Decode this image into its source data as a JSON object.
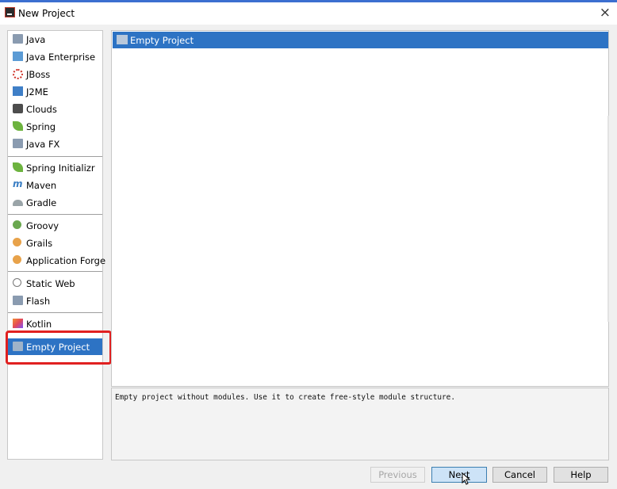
{
  "window": {
    "title": "New Project",
    "close_icon": "×"
  },
  "sidebar": {
    "items": [
      {
        "label": "Java",
        "icon": "folder-icon"
      },
      {
        "label": "Java Enterprise",
        "icon": "java-enterprise-icon"
      },
      {
        "label": "JBoss",
        "icon": "jboss-icon"
      },
      {
        "label": "J2ME",
        "icon": "j2me-icon"
      },
      {
        "label": "Clouds",
        "icon": "clouds-icon"
      },
      {
        "label": "Spring",
        "icon": "spring-icon"
      },
      {
        "label": "Java FX",
        "icon": "folder-icon"
      },
      {
        "label": "Spring Initializr",
        "icon": "spring-initializr-icon"
      },
      {
        "label": "Maven",
        "icon": "maven-icon"
      },
      {
        "label": "Gradle",
        "icon": "gradle-icon"
      },
      {
        "label": "Groovy",
        "icon": "groovy-icon"
      },
      {
        "label": "Grails",
        "icon": "grails-icon"
      },
      {
        "label": "Application Forge",
        "icon": "application-forge-icon"
      },
      {
        "label": "Static Web",
        "icon": "static-web-icon"
      },
      {
        "label": "Flash",
        "icon": "flash-icon"
      },
      {
        "label": "Kotlin",
        "icon": "kotlin-icon"
      },
      {
        "label": "Empty Project",
        "icon": "folder-icon"
      }
    ],
    "selected": "Empty Project"
  },
  "main": {
    "items": [
      {
        "label": "Empty Project",
        "icon": "folder-icon"
      }
    ],
    "description": "Empty project without modules. Use it to create free-style module structure."
  },
  "buttons": {
    "previous": "Previous",
    "next": "Next",
    "cancel": "Cancel",
    "help": "Help"
  },
  "colors": {
    "selection": "#2d73c4",
    "highlight_box": "#e02020"
  }
}
